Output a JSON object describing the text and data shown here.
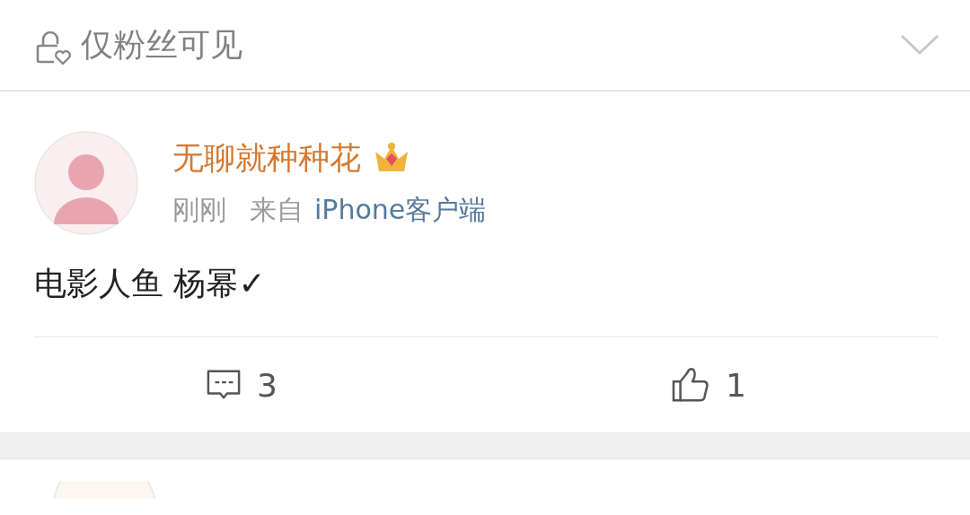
{
  "visibility": {
    "label": "仅粉丝可见"
  },
  "post": {
    "author": "无聊就种种花",
    "time": "刚刚",
    "source_prefix": "来自",
    "source": "iPhone客户端",
    "text": "电影人鱼 杨幂✓",
    "comments": "3",
    "likes": "1"
  }
}
